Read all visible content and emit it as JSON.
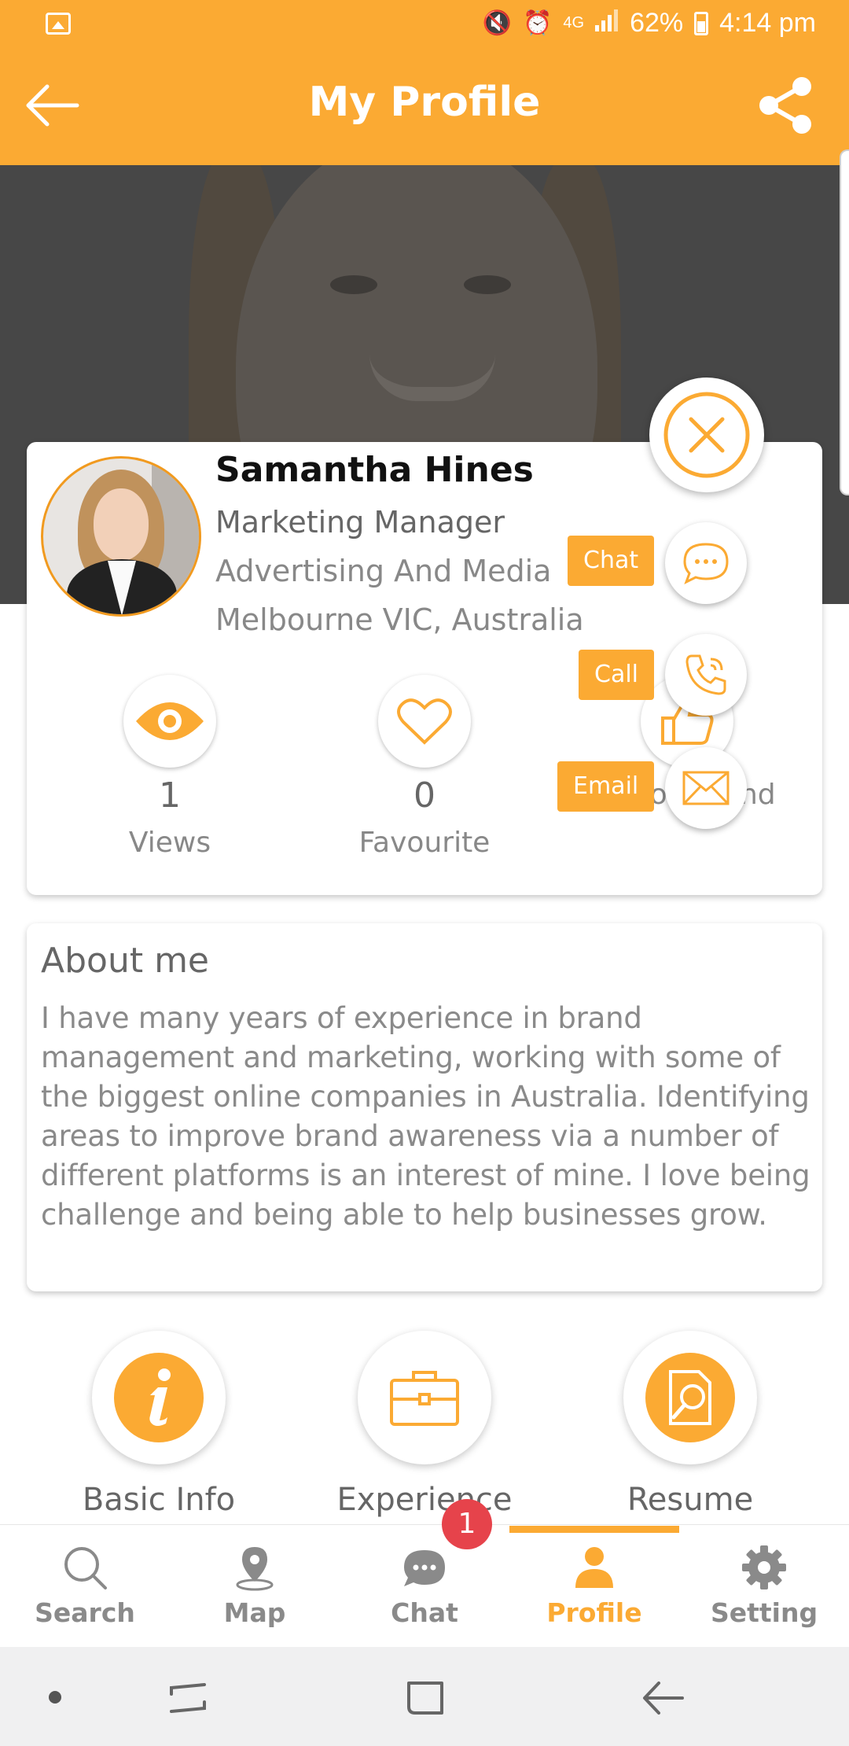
{
  "colors": {
    "accent": "#FBAA33",
    "badge": "#E6434B",
    "text_dark": "#111111",
    "text_grey": "#888888"
  },
  "status_bar": {
    "battery": "62%",
    "time": "4:14 pm",
    "network": "4G"
  },
  "app_bar": {
    "title": "My Profile",
    "back_icon": "arrow-left-icon",
    "share_icon": "share-icon"
  },
  "profile": {
    "name": "Samantha Hines",
    "role": "Marketing Manager",
    "industry": "Advertising And Media",
    "location": "Melbourne VIC, Australia"
  },
  "stats": [
    {
      "icon": "eye-icon",
      "count": "1",
      "label": "Views"
    },
    {
      "icon": "heart-icon",
      "count": "0",
      "label": "Favourite"
    },
    {
      "icon": "thumbs-up-icon",
      "label": "Recommend"
    }
  ],
  "fab_actions": [
    {
      "label": "Chat",
      "icon": "chat-bubble-icon"
    },
    {
      "label": "Call",
      "icon": "phone-icon"
    },
    {
      "label": "Email",
      "icon": "envelope-icon"
    }
  ],
  "about": {
    "title": "About me",
    "text": "I have many years of experience in brand management and marketing, working with some of the biggest online companies in Australia. Identifying areas to improve brand awareness via a number of different platforms is an interest of mine. I love being challenge and being able to help businesses grow."
  },
  "quick_actions": [
    {
      "label": "Basic Info",
      "icon": "info-icon"
    },
    {
      "label": "Experience",
      "icon": "briefcase-icon"
    },
    {
      "label": "Resume",
      "icon": "resume-search-icon"
    }
  ],
  "bottom_nav": {
    "items": [
      {
        "label": "Search",
        "icon": "search-icon"
      },
      {
        "label": "Map",
        "icon": "map-pin-icon"
      },
      {
        "label": "Chat",
        "icon": "chat-icon"
      },
      {
        "label": "Profile",
        "icon": "person-icon"
      },
      {
        "label": "Setting",
        "icon": "gear-icon"
      }
    ],
    "active": "Profile",
    "chat_badge": "1"
  }
}
